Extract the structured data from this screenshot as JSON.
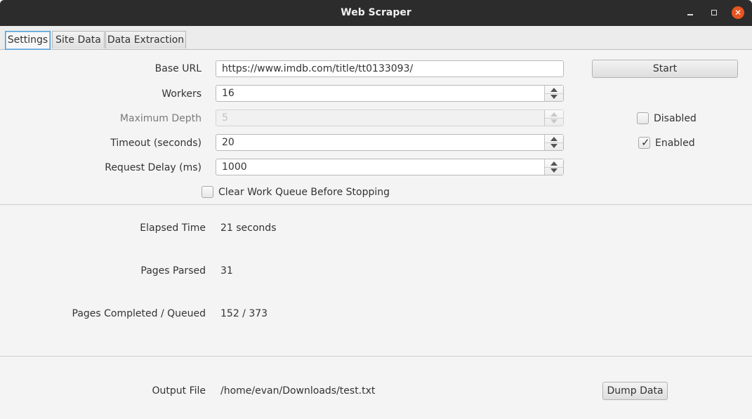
{
  "window": {
    "title": "Web Scraper"
  },
  "tabs": [
    {
      "label": "Settings",
      "active": true
    },
    {
      "label": "Site Data",
      "active": false
    },
    {
      "label": "Data Extraction",
      "active": false
    }
  ],
  "settings": {
    "base_url": {
      "label": "Base URL",
      "value": "https://www.imdb.com/title/tt0133093/"
    },
    "workers": {
      "label": "Workers",
      "value": "16"
    },
    "max_depth": {
      "label": "Maximum Depth",
      "value": "5",
      "disabled": true
    },
    "timeout": {
      "label": "Timeout (seconds)",
      "value": "20"
    },
    "request_delay": {
      "label": "Request Delay (ms)",
      "value": "1000"
    },
    "clear_queue": {
      "label": "Clear Work Queue Before Stopping",
      "checked": false
    },
    "start_button": "Start",
    "depth_toggle": {
      "label": "Disabled",
      "checked": false
    },
    "timeout_toggle": {
      "label": "Enabled",
      "checked": true
    }
  },
  "stats": {
    "elapsed_time": {
      "label": "Elapsed Time",
      "value": "21 seconds"
    },
    "pages_parsed": {
      "label": "Pages Parsed",
      "value": "31"
    },
    "pages_completed": {
      "label": "Pages Completed / Queued",
      "value": "152 / 373"
    }
  },
  "output": {
    "label": "Output File",
    "path": "/home/evan/Downloads/test.txt",
    "dump_button": "Dump Data"
  },
  "colors": {
    "titlebar": "#2c2c2c",
    "close_button": "#e95420",
    "tab_focus": "#4a9bd6"
  }
}
